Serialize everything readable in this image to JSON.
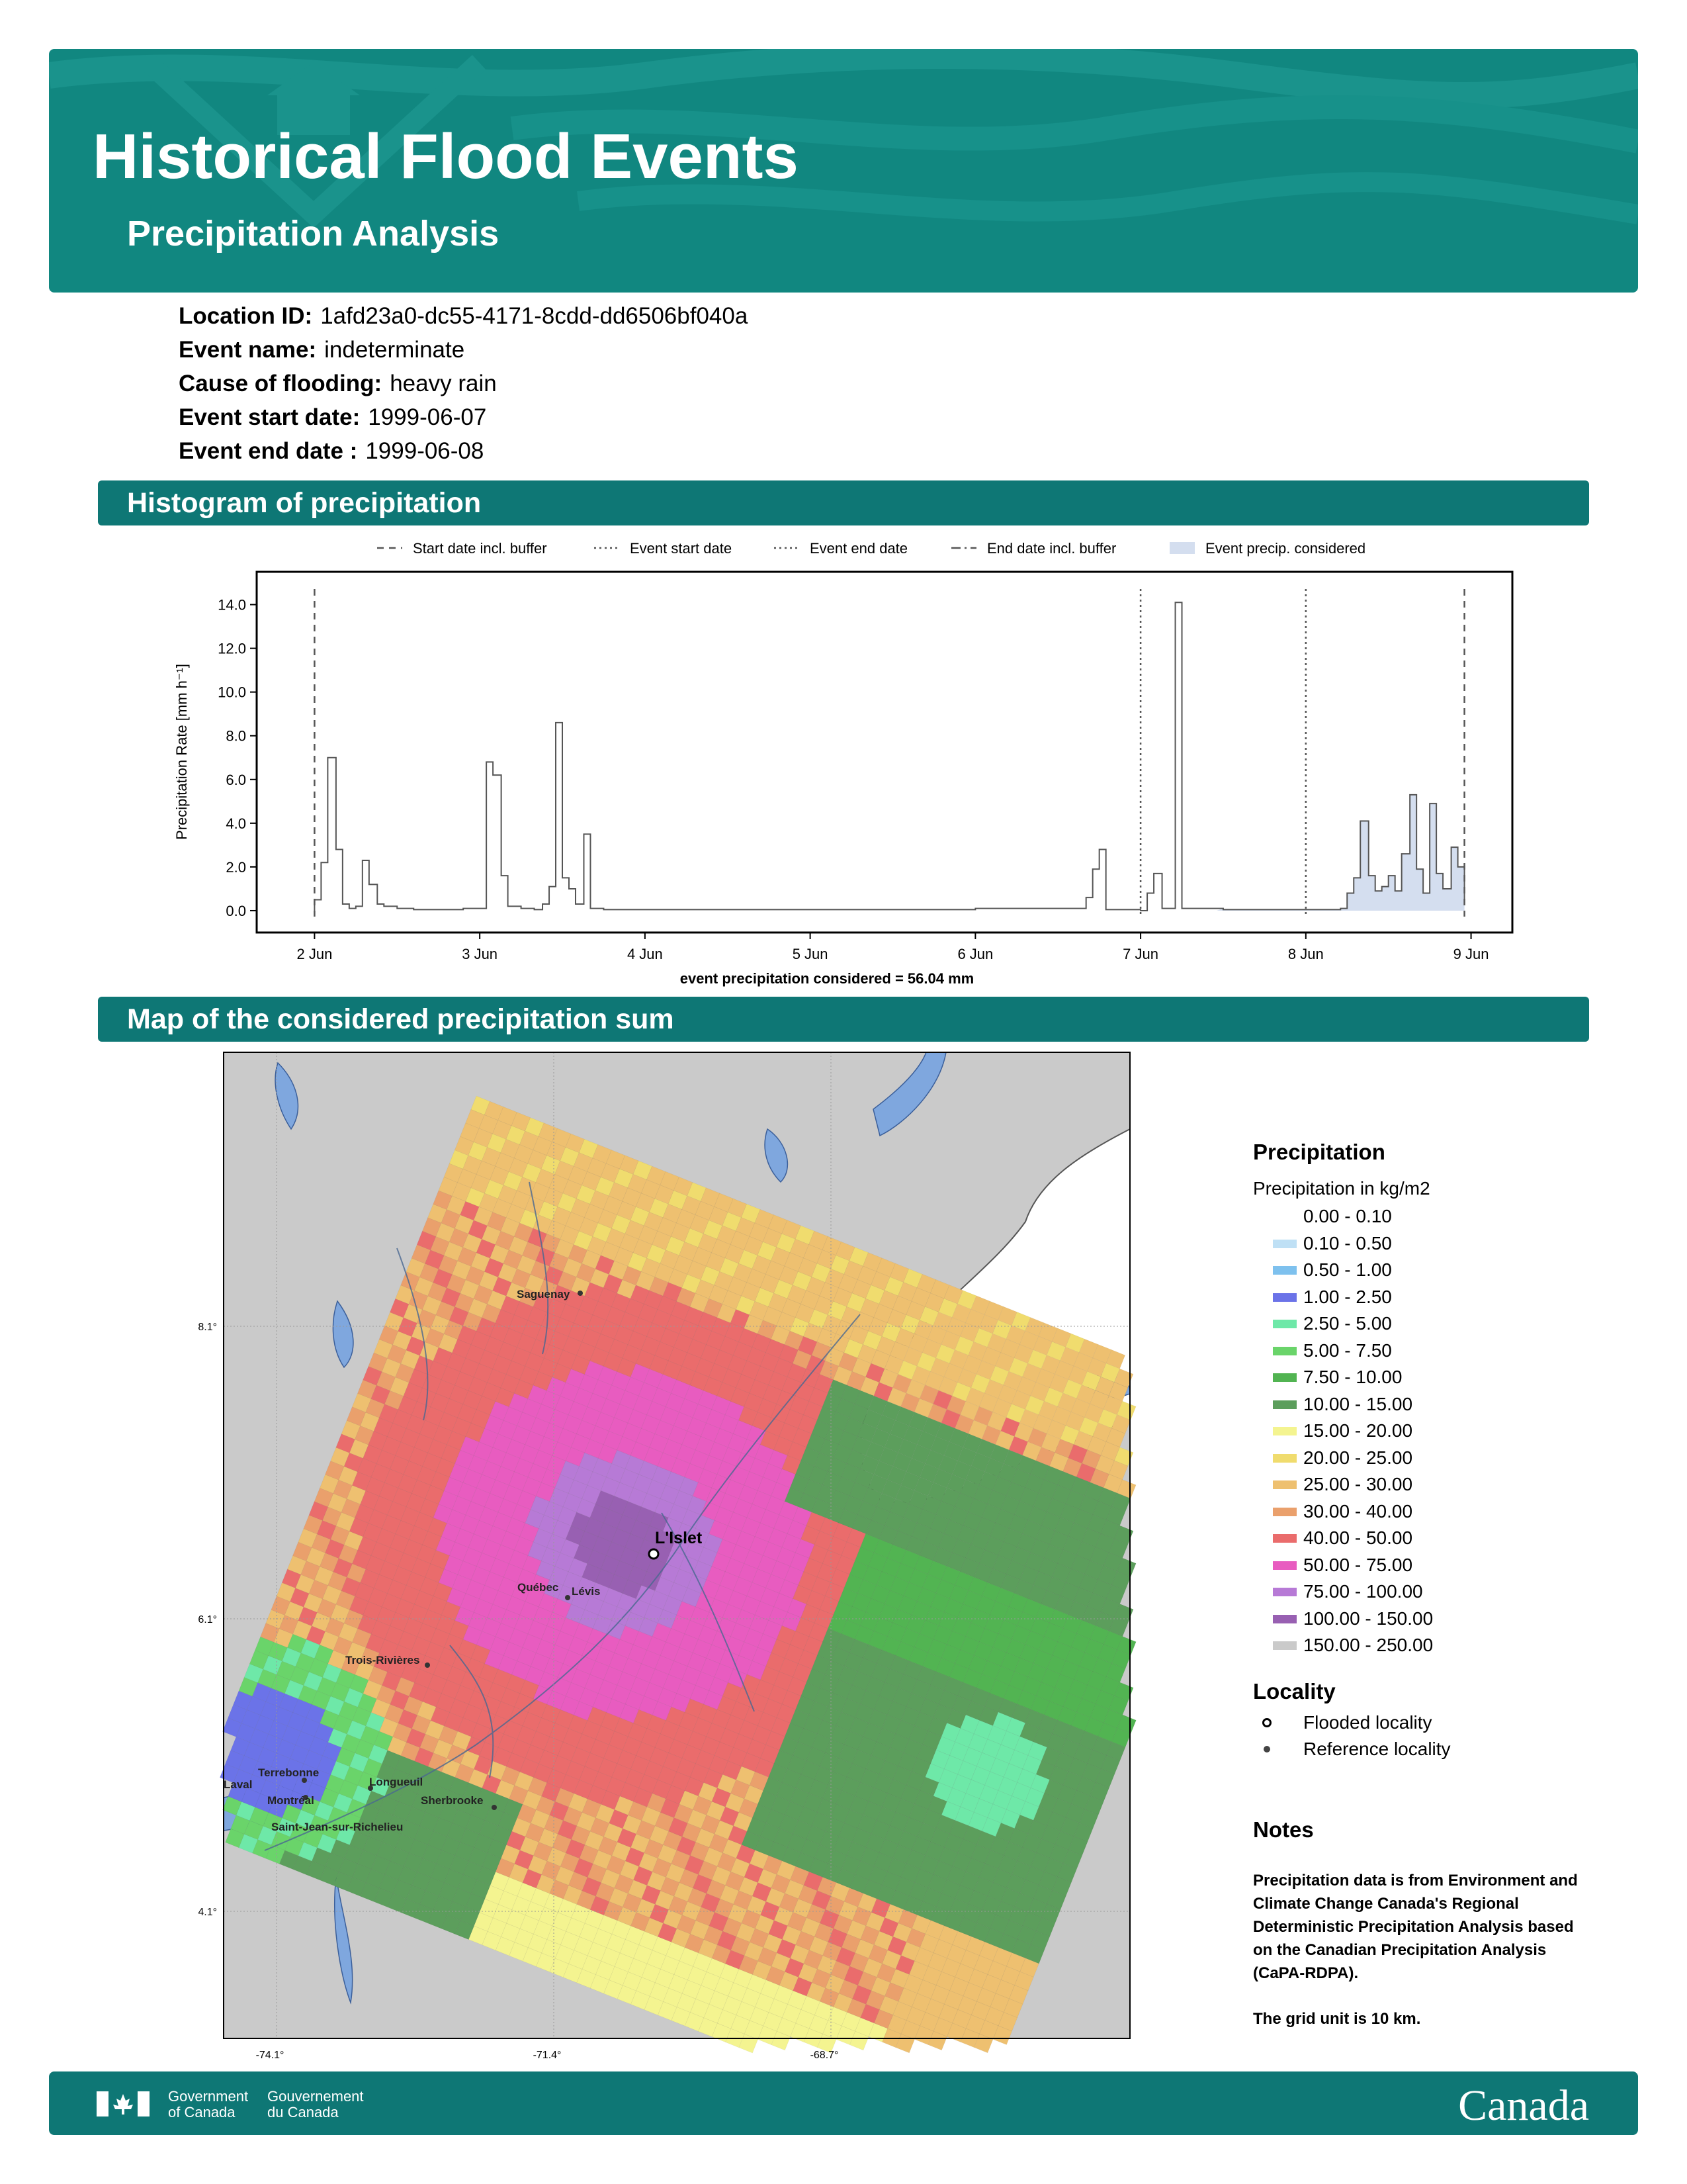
{
  "header": {
    "title": "Historical Flood Events",
    "subtitle": "Precipitation Analysis",
    "brand_color": "#118780"
  },
  "event": {
    "location_id": {
      "label": "Location ID:",
      "value": "1afd23a0-dc55-4171-8cdd-dd6506bf040a"
    },
    "event_name": {
      "label": "Event name:",
      "value": "indeterminate"
    },
    "cause": {
      "label": "Cause of flooding:",
      "value": "heavy rain"
    },
    "start": {
      "label": "Event start date:",
      "value": "1999-06-07"
    },
    "end": {
      "label": "Event end date :",
      "value": "1999-06-08"
    }
  },
  "sections": {
    "histogram": "Histogram of precipitation",
    "map": "Map of the considered precipitation sum"
  },
  "chart_data": {
    "type": "line",
    "ylabel": "Precipitation Rate [mm h⁻¹]",
    "xlabel": "event precipitation considered = 56.04 mm",
    "ylim": [
      -1.0,
      15.5
    ],
    "xlim": [
      -0.35,
      7.25
    ],
    "yticks": [
      "0.0",
      "2.0",
      "4.0",
      "6.0",
      "8.0",
      "10.0",
      "12.0",
      "14.0"
    ],
    "xticks": [
      "2 Jun",
      "3 Jun",
      "4 Jun",
      "5 Jun",
      "6 Jun",
      "7 Jun",
      "8 Jun",
      "9 Jun"
    ],
    "legend": [
      {
        "label": "Start date incl. buffer",
        "style": "dashed"
      },
      {
        "label": "Event start date",
        "style": "dotted"
      },
      {
        "label": "Event end date",
        "style": "dotted"
      },
      {
        "label": "End date incl. buffer",
        "style": "dashdot"
      },
      {
        "label": "Event precip. considered",
        "style": "fill"
      }
    ],
    "legend_position": "top",
    "vlines": [
      {
        "x": 0.0,
        "style": "dashed"
      },
      {
        "x": 5.0,
        "style": "dotted"
      },
      {
        "x": 6.0,
        "style": "dotted"
      },
      {
        "x": 6.96,
        "style": "dashed"
      }
    ],
    "fill_color": "#d4deef",
    "considered_x": [
      5.46,
      6.96
    ],
    "series_points": [
      [
        0.0,
        0.0
      ],
      [
        0.0,
        0.5
      ],
      [
        0.04,
        2.2
      ],
      [
        0.08,
        7.0
      ],
      [
        0.13,
        2.8
      ],
      [
        0.17,
        0.3
      ],
      [
        0.21,
        0.1
      ],
      [
        0.25,
        0.2
      ],
      [
        0.29,
        2.3
      ],
      [
        0.33,
        1.2
      ],
      [
        0.38,
        0.3
      ],
      [
        0.42,
        0.2
      ],
      [
        0.5,
        0.1
      ],
      [
        0.6,
        0.05
      ],
      [
        0.8,
        0.05
      ],
      [
        0.9,
        0.1
      ],
      [
        1.0,
        0.1
      ],
      [
        1.04,
        6.8
      ],
      [
        1.08,
        6.2
      ],
      [
        1.13,
        1.6
      ],
      [
        1.17,
        0.2
      ],
      [
        1.25,
        0.1
      ],
      [
        1.33,
        0.05
      ],
      [
        1.38,
        0.3
      ],
      [
        1.42,
        1.1
      ],
      [
        1.46,
        8.6
      ],
      [
        1.5,
        1.5
      ],
      [
        1.54,
        1.0
      ],
      [
        1.58,
        0.3
      ],
      [
        1.63,
        3.5
      ],
      [
        1.67,
        0.1
      ],
      [
        1.75,
        0.05
      ],
      [
        2.0,
        0.05
      ],
      [
        3.0,
        0.05
      ],
      [
        3.5,
        0.05
      ],
      [
        4.0,
        0.1
      ],
      [
        4.5,
        0.1
      ],
      [
        4.63,
        0.1
      ],
      [
        4.67,
        0.6
      ],
      [
        4.71,
        1.9
      ],
      [
        4.75,
        2.8
      ],
      [
        4.79,
        0.05
      ],
      [
        5.0,
        0.0
      ],
      [
        5.04,
        0.8
      ],
      [
        5.08,
        1.7
      ],
      [
        5.13,
        0.1
      ],
      [
        5.17,
        0.1
      ],
      [
        5.21,
        14.1
      ],
      [
        5.25,
        0.1
      ],
      [
        5.5,
        0.05
      ],
      [
        5.75,
        0.05
      ],
      [
        6.0,
        0.05
      ],
      [
        6.21,
        0.1
      ],
      [
        6.25,
        0.8
      ],
      [
        6.29,
        1.5
      ],
      [
        6.33,
        4.1
      ],
      [
        6.38,
        1.6
      ],
      [
        6.42,
        0.9
      ],
      [
        6.46,
        1.1
      ],
      [
        6.5,
        1.6
      ],
      [
        6.54,
        0.9
      ],
      [
        6.58,
        2.6
      ],
      [
        6.63,
        5.3
      ],
      [
        6.67,
        1.9
      ],
      [
        6.71,
        0.8
      ],
      [
        6.75,
        4.9
      ],
      [
        6.79,
        1.7
      ],
      [
        6.83,
        1.0
      ],
      [
        6.88,
        2.9
      ],
      [
        6.92,
        2.0
      ],
      [
        6.96,
        0.3
      ]
    ]
  },
  "map": {
    "lat_ticks": [
      "+48.1°",
      "+46.1°",
      "+44.1°"
    ],
    "lon_ticks": [
      "-74.1°",
      "-71.4°",
      "-68.7°"
    ],
    "flooded_label": "L'Islet",
    "cities": [
      {
        "name": "Saguenay"
      },
      {
        "name": "Québec"
      },
      {
        "name": "Lévis"
      },
      {
        "name": "Trois-Rivières"
      },
      {
        "name": "Terrebonne"
      },
      {
        "name": "Laval"
      },
      {
        "name": "Montréal"
      },
      {
        "name": "Longueuil"
      },
      {
        "name": "Sherbrooke"
      },
      {
        "name": "Saint-Jean-sur-Richelieu"
      }
    ]
  },
  "legend": {
    "title": "Precipitation",
    "subtitle": "Precipitation in kg/m2",
    "classes": [
      {
        "label": "0.00 - 0.10",
        "color": "#ffffff"
      },
      {
        "label": "0.10 - 0.50",
        "color": "#bfe0f5"
      },
      {
        "label": "0.50 - 1.00",
        "color": "#7ec1ee"
      },
      {
        "label": "1.00 - 2.50",
        "color": "#6b73e8"
      },
      {
        "label": "2.50 - 5.00",
        "color": "#6ee8a8"
      },
      {
        "label": "5.00 - 7.50",
        "color": "#6ad46a"
      },
      {
        "label": "7.50 - 10.00",
        "color": "#52b452"
      },
      {
        "label": "10.00 - 15.00",
        "color": "#5c9e5c"
      },
      {
        "label": "15.00 - 20.00",
        "color": "#f4f490"
      },
      {
        "label": "20.00 - 25.00",
        "color": "#f0dc6e"
      },
      {
        "label": "25.00 - 30.00",
        "color": "#eec070"
      },
      {
        "label": "30.00 - 40.00",
        "color": "#eaa06c"
      },
      {
        "label": "40.00 - 50.00",
        "color": "#ea6c6c"
      },
      {
        "label": "50.00 - 75.00",
        "color": "#e85cc0"
      },
      {
        "label": "75.00 - 100.00",
        "color": "#b77ad6"
      },
      {
        "label": "100.00 - 150.00",
        "color": "#9860b2"
      },
      {
        "label": "150.00 - 250.00",
        "color": "#cacaca"
      }
    ],
    "locality_title": "Locality",
    "flooded": "Flooded locality",
    "reference": "Reference locality"
  },
  "notes": {
    "title": "Notes",
    "text": "Precipitation data is from Environment and Climate Change Canada's Regional Deterministic Precipitation Analysis based on the Canadian Precipitation Analysis (CaPA-RDPA).",
    "grid": "The grid unit is 10 km."
  },
  "footer": {
    "gov_en_1": "Government",
    "gov_en_2": "of Canada",
    "gov_fr_1": "Gouvernement",
    "gov_fr_2": "du Canada",
    "wordmark": "Canada"
  }
}
